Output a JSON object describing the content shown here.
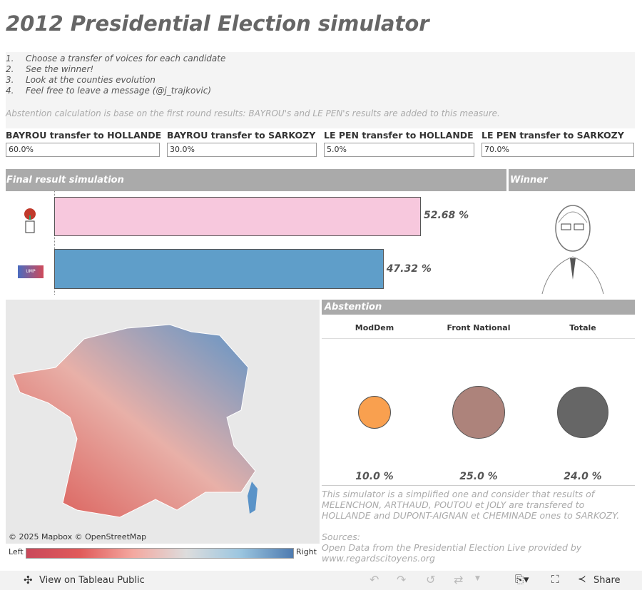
{
  "title": "2012 Presidential Election simulator",
  "instructions": [
    {
      "n": "1.",
      "text": "Choose a transfer of voices for each candidate"
    },
    {
      "n": "2.",
      "text": "See the winner!"
    },
    {
      "n": "3.",
      "text": "Look at the counties evolution"
    },
    {
      "n": "4.",
      "text": "Feel free to leave a message (@j_trajkovic)"
    }
  ],
  "abstention_note": "Abstention calculation is base on the first round results: BAYROU's and LE PEN's results are added to this measure.",
  "parameters": [
    {
      "label": "BAYROU transfer to HOLLANDE",
      "value": "60.0%"
    },
    {
      "label": "BAYROU transfer to SARKOZY",
      "value": "30.0%"
    },
    {
      "label": "LE PEN transfer to HOLLANDE",
      "value": "5.0%"
    },
    {
      "label": "LE PEN transfer to SARKOZY",
      "value": "70.0%"
    }
  ],
  "result": {
    "header": "Final result simulation",
    "winner_header": "Winner",
    "bars": [
      {
        "party": "PS",
        "value": 52.68,
        "label": "52.68 %",
        "color": "#f7c8dd"
      },
      {
        "party": "UMP",
        "value": 47.32,
        "label": "47.32 %",
        "color": "#5f9ec9"
      }
    ],
    "ump_logo": "UMP"
  },
  "map": {
    "attribution": "© 2025 Mapbox  © OpenStreetMap",
    "legend_left": "Left",
    "legend_right": "Right"
  },
  "abstention": {
    "header": "Abstention",
    "columns": [
      {
        "name": "ModDem",
        "value": "10.0 %",
        "color": "#f9a04f"
      },
      {
        "name": "Front National",
        "value": "25.0 %",
        "color": "#ad837b"
      },
      {
        "name": "Totale",
        "value": "24.0 %",
        "color": "#666666"
      }
    ]
  },
  "disclaimer": "This simulator is a simplified one and consider that results of MELENCHON, ARTHAUD, POUTOU et JOLY are transfered to HOLLANDE and DUPONT-AIGNAN et CHEMINADE ones to SARKOZY.",
  "sources_label": "Sources:",
  "sources_text": "Open Data from the Presidential Election Live provided by www.regardscitoyens.org",
  "toolbar": {
    "view_label": "View on Tableau Public",
    "share_label": "Share"
  }
}
